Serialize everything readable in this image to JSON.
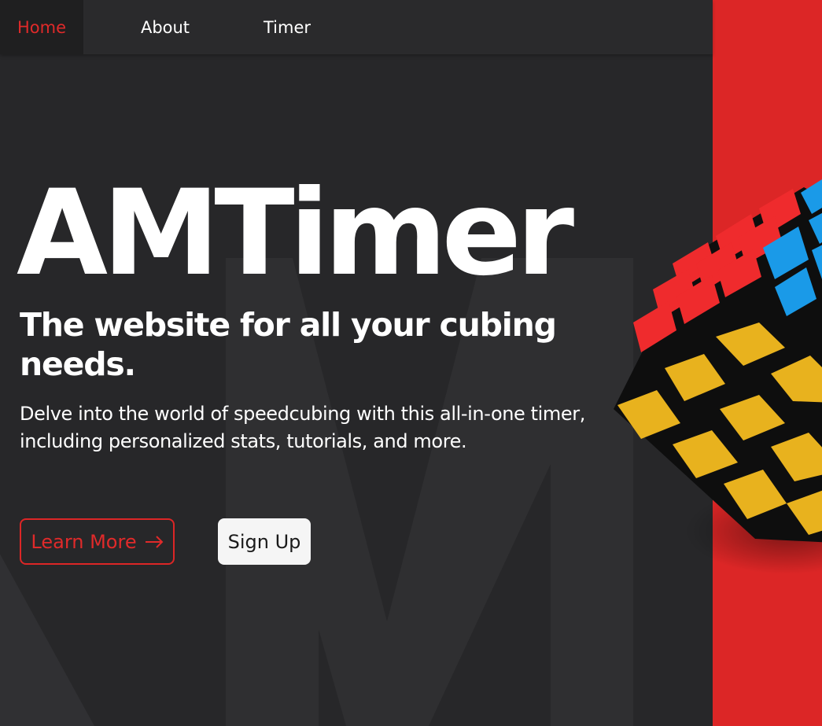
{
  "nav": {
    "items": [
      {
        "label": "Home",
        "active": true
      },
      {
        "label": "About",
        "active": false
      },
      {
        "label": "Timer",
        "active": false
      }
    ]
  },
  "hero": {
    "title": "AMTimer",
    "subtitle": "The website for all your cubing needs.",
    "description": "Delve into the world of speedcubing with this all-in-one timer, including personalized stats, tutorials, and more.",
    "learn_more_label": "Learn More",
    "sign_up_label": "Sign Up",
    "background_letter": "M"
  },
  "theme": {
    "background": "#272729",
    "nav_background": "#2a2a2c",
    "accent_red": "#dc2626",
    "text": "#ffffff"
  },
  "icons": {
    "learn_more_arrow": "arrow-right-icon",
    "cube_image": "rubiks-cube-image"
  }
}
